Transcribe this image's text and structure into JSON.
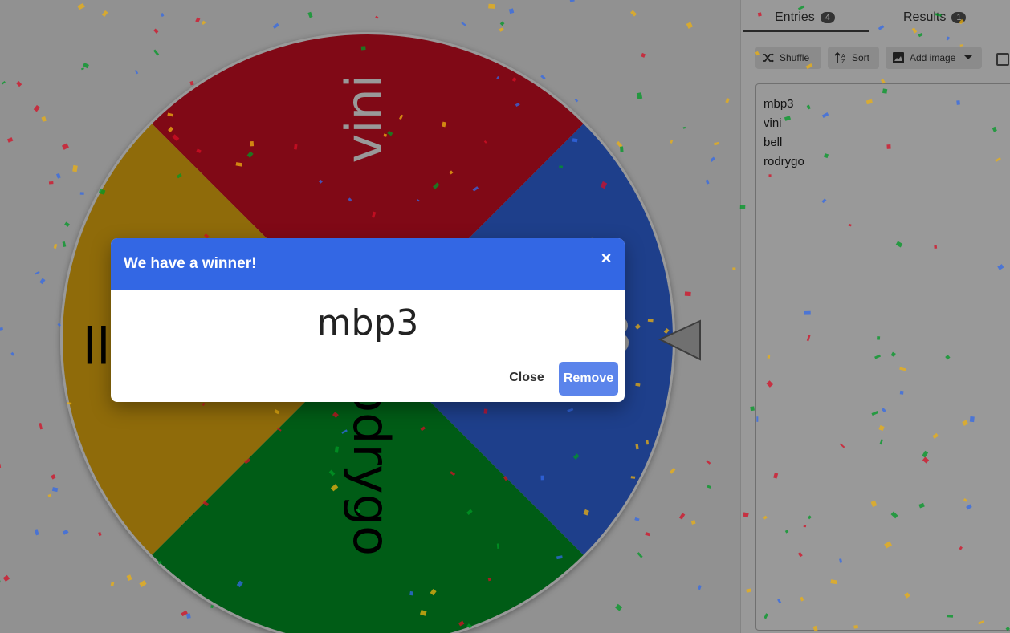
{
  "wheel": {
    "segments": [
      {
        "label": "mbp3",
        "color": "#3369e8"
      },
      {
        "label": "vini",
        "color": "#d50f25"
      },
      {
        "label": "bell",
        "color": "#eeb211"
      },
      {
        "label": "rodrygo",
        "color": "#009925"
      }
    ]
  },
  "sidebar": {
    "tabs": [
      {
        "label": "Entries",
        "count": "4"
      },
      {
        "label": "Results",
        "count": "1"
      }
    ],
    "toolbar": {
      "shuffle_label": "Shuffle",
      "sort_label": "Sort",
      "add_image_label": "Add image"
    },
    "entries": [
      "mbp3",
      "vini",
      "bell",
      "rodrygo"
    ]
  },
  "dialog": {
    "title": "We have a winner!",
    "close_symbol": "×",
    "winner": "mbp3",
    "close_label": "Close",
    "remove_label": "Remove"
  },
  "colors": {
    "dialog_header": "#3367e4",
    "remove_button": "#3f6fe8"
  },
  "icons": [
    "shuffle-icon",
    "sort-icon",
    "image-icon",
    "dropdown-arrow-icon",
    "close-icon",
    "pointer-icon"
  ]
}
